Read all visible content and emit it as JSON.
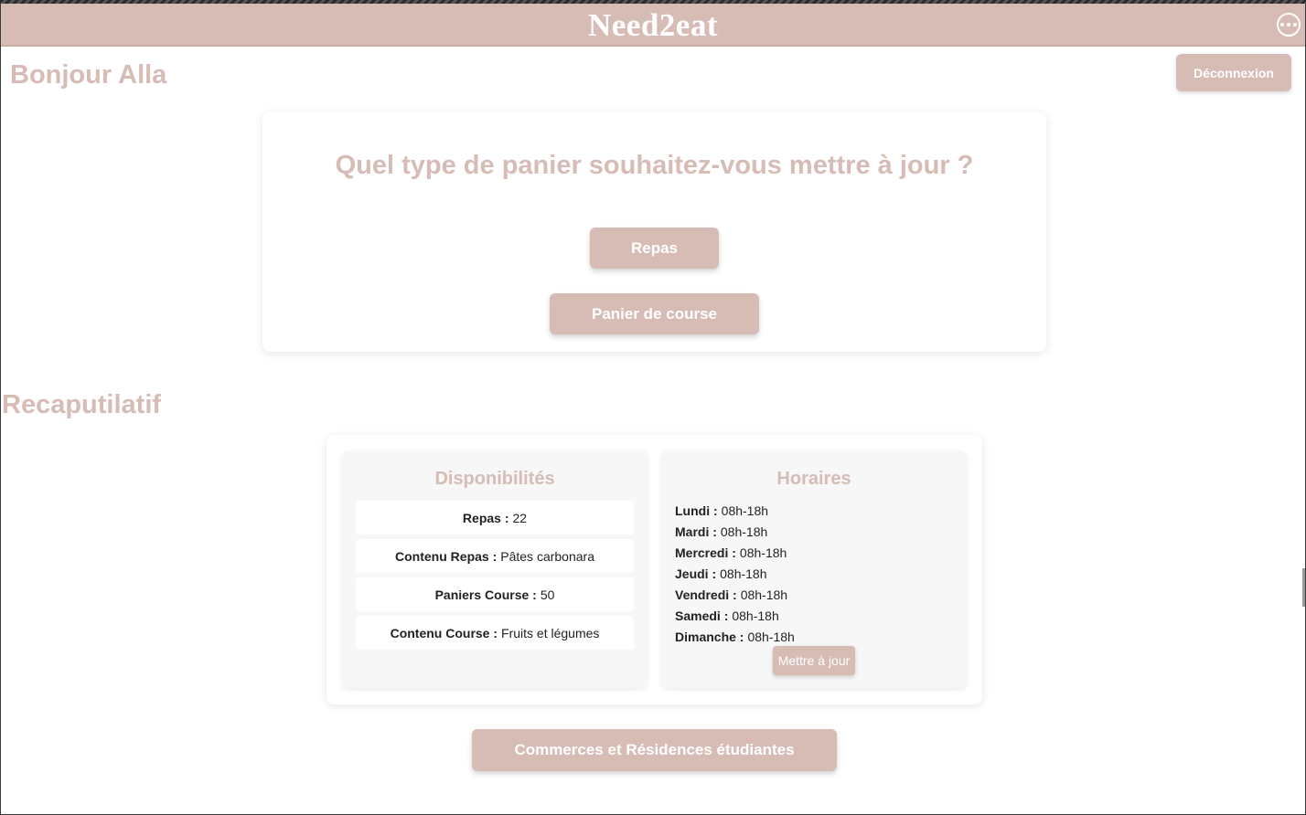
{
  "app": {
    "brand": "Need2eat"
  },
  "header": {
    "greeting": "Bonjour Alla",
    "logout_label": "Déconnexion",
    "more_icon": "more-horizontal-icon"
  },
  "basket_choice": {
    "question": "Quel type de panier souhaitez-vous mettre à jour ?",
    "repas_label": "Repas",
    "panier_label": "Panier de course"
  },
  "recap": {
    "title": "Recaputilatif",
    "availability": {
      "title": "Disponibilités",
      "items": [
        {
          "label": "Repas :",
          "value": "22"
        },
        {
          "label": "Contenu Repas :",
          "value": "Pâtes carbonara"
        },
        {
          "label": "Paniers Course :",
          "value": "50"
        },
        {
          "label": "Contenu Course :",
          "value": "Fruits et légumes"
        }
      ]
    },
    "schedule": {
      "title": "Horaires",
      "days": [
        {
          "label": "Lundi :",
          "value": "08h-18h"
        },
        {
          "label": "Mardi :",
          "value": "08h-18h"
        },
        {
          "label": "Mercredi :",
          "value": "08h-18h"
        },
        {
          "label": "Jeudi :",
          "value": "08h-18h"
        },
        {
          "label": "Vendredi :",
          "value": "08h-18h"
        },
        {
          "label": "Samedi :",
          "value": "08h-18h"
        },
        {
          "label": "Dimanche :",
          "value": "08h-18h"
        }
      ],
      "update_label": "Mettre à jour"
    }
  },
  "footer_button": "Commerces et Résidences étudiantes",
  "colors": {
    "accent": "#d6bcb4",
    "panel": "#f7f7f7",
    "text": "#222222"
  }
}
